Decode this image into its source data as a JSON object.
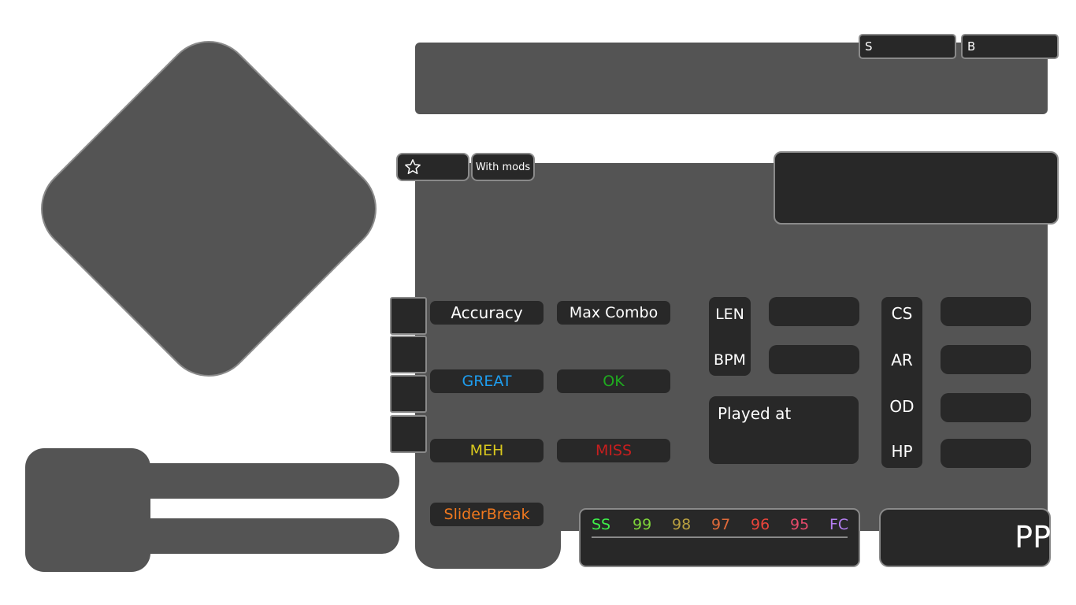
{
  "ranks": {
    "s_label": "S",
    "b_label": "B"
  },
  "buttons": {
    "favorite_icon": "star-outline-icon",
    "with_mods": "With mods"
  },
  "stats": {
    "accuracy": "Accuracy",
    "max_combo": "Max Combo",
    "great": "GREAT",
    "ok": "OK",
    "meh": "MEH",
    "miss": "MISS",
    "slider_break": "SliderBreak"
  },
  "beatmap": {
    "len": "LEN",
    "bpm": "BPM",
    "played_at": "Played at",
    "cs": "CS",
    "ar": "AR",
    "od": "OD",
    "hp": "HP"
  },
  "accuracy_bar": {
    "labels": [
      {
        "text": "SS",
        "color": "#3ef04a"
      },
      {
        "text": "99",
        "color": "#7ed43a"
      },
      {
        "text": "98",
        "color": "#b9a040"
      },
      {
        "text": "97",
        "color": "#e06a3a"
      },
      {
        "text": "96",
        "color": "#e8443a"
      },
      {
        "text": "95",
        "color": "#e64a6a"
      },
      {
        "text": "FC",
        "color": "#b47ef0"
      }
    ]
  },
  "pp": {
    "label": "PP"
  },
  "colors": {
    "panel": "#545454",
    "box": "#282828",
    "border": "#8a8a8a",
    "great": "#1e9ef0",
    "ok": "#1faa1f",
    "meh": "#d9c81e",
    "miss": "#c81e1e",
    "slider_break": "#f0781e"
  }
}
